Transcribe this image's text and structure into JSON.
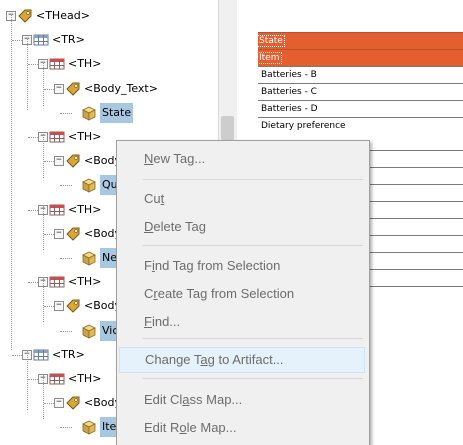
{
  "tree": {
    "items": [
      {
        "label": "<THead>",
        "icon": "tag-icon",
        "toggle": "−",
        "selected": false
      },
      {
        "label": "<TR>",
        "icon": "table-row-icon",
        "toggle": "−",
        "selected": false
      },
      {
        "label": "<TH>",
        "icon": "table-header-cell-icon",
        "toggle": "−",
        "selected": false
      },
      {
        "label": "<Body_Text>",
        "icon": "tag-icon",
        "toggle": "−",
        "selected": false
      },
      {
        "label": "State",
        "icon": "content-box-icon",
        "toggle": "",
        "selected": true
      },
      {
        "label": "<TH>",
        "icon": "table-header-cell-icon",
        "toggle": "−",
        "selected": false
      },
      {
        "label": "<Body_Text>",
        "icon": "tag-icon",
        "toggle": "−",
        "selected": false
      },
      {
        "label": "Question",
        "icon": "content-box-icon",
        "toggle": "",
        "selected": true
      },
      {
        "label": "<TH>",
        "icon": "table-header-cell-icon",
        "toggle": "−",
        "selected": false
      },
      {
        "label": "<Body_Text>",
        "icon": "tag-icon",
        "toggle": "−",
        "selected": false
      },
      {
        "label": "New Hampshire",
        "icon": "content-box-icon",
        "toggle": "",
        "selected": true
      },
      {
        "label": "<TH>",
        "icon": "table-header-cell-icon",
        "toggle": "−",
        "selected": false
      },
      {
        "label": "<Body_Text>",
        "icon": "tag-icon",
        "toggle": "−",
        "selected": false
      },
      {
        "label": "Victoria",
        "icon": "content-box-icon",
        "toggle": "",
        "selected": true
      },
      {
        "label": "<TR>",
        "icon": "table-row-icon",
        "toggle": "−",
        "selected": false
      },
      {
        "label": "<TH>",
        "icon": "table-header-cell-icon",
        "toggle": "−",
        "selected": false
      },
      {
        "label": "<Body_Text>",
        "icon": "tag-icon",
        "toggle": "−",
        "selected": false
      },
      {
        "label": "Item",
        "icon": "content-box-icon",
        "toggle": "",
        "selected": true
      }
    ]
  },
  "document": {
    "rows": [
      {
        "text": "State",
        "highlighted": true
      },
      {
        "text": "Item",
        "highlighted": true
      },
      {
        "text": "Batteries - B",
        "highlighted": false
      },
      {
        "text": "Batteries - C",
        "highlighted": false
      },
      {
        "text": "Batteries - D",
        "highlighted": false
      },
      {
        "text": "Dietary preference",
        "highlighted": false
      }
    ],
    "highlight_color": "#e35f2f"
  },
  "context_menu": {
    "items": [
      {
        "label": "New Tag...",
        "u": 0,
        "hover": false
      },
      {
        "label": "Cut",
        "u": 2,
        "hover": false
      },
      {
        "label": "Delete Tag",
        "u": 0,
        "hover": false
      },
      {
        "label": "Find Tag from Selection",
        "u": 1,
        "hover": false
      },
      {
        "label": "Create Tag from Selection",
        "u": 1,
        "hover": false
      },
      {
        "label": "Find...",
        "u": 0,
        "hover": false
      },
      {
        "label": "Change Tag to Artifact...",
        "u": 8,
        "hover": true
      },
      {
        "label": "Edit Class Map...",
        "u": 7,
        "hover": false
      },
      {
        "label": "Edit Role Map...",
        "u": 6,
        "hover": false
      }
    ]
  }
}
